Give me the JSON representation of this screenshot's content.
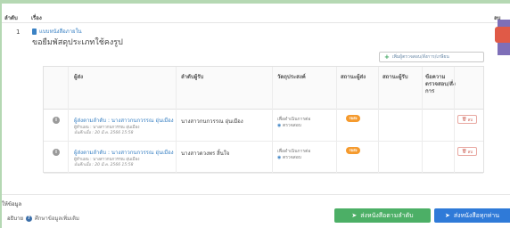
{
  "header": {
    "order": "ลำดับ",
    "subject": "เรื่อง",
    "right": "ลบ"
  },
  "document": {
    "row_number": "1",
    "type_link": "แบบหนังสือภายใน",
    "title": "ขอยืมพัสดุประเภทใช้คงรูป"
  },
  "add_button": {
    "label": "เพิ่มผู้ตรวจสอบ/สั่งการ/เกษียน"
  },
  "table": {
    "columns": [
      "ผู้ส่ง",
      "ลำดับผู้รับ",
      "วัตถุประสงค์",
      "สถานะผู้ส่ง",
      "สถานะผู้รับ",
      "ข้อความตรวจสอบ/สั่งการ"
    ],
    "rows": [
      {
        "info_icon": "i",
        "sender": "ผู้ส่งตามลำดับ : นางสาวกนกวรรณ อุ่นเมือง",
        "sender_sub": "ผู้ทำแผน : นางสาวกนกวรรณ อุ่นเมือง",
        "sender_date": "บันทึกเมื่อ : 20 มี.ค. 2566 15:58",
        "receiver": "นางสาวกนกวรรณ อุ่นเมือง",
        "purpose_line1": "เพื่อดำเนินการต่อ",
        "purpose_line2": "ตรวจสอบ",
        "status": "รอส่ง",
        "cancel": "ลบ"
      },
      {
        "info_icon": "i",
        "sender": "ผู้ส่งตามลำดับ : นางสาวกนกวรรณ อุ่นเมือง",
        "sender_sub": "ผู้ทำแผน : นางสาวกนกวรรณ อุ่นเมือง",
        "sender_date": "บันทึกเมื่อ : 20 มี.ค. 2566 15:58",
        "receiver": "นางสาวดวงพร สิ้นใจ",
        "purpose_line1": "เพื่อดำเนินการต่อ",
        "purpose_line2": "ตรวจสอบ",
        "status": "รอส่ง",
        "cancel": "ลบ"
      }
    ]
  },
  "footer": {
    "label": "ให้ข้อมูล",
    "explain": "อธิบาย",
    "note": "ศึกษาข้อมูลเพิ่มเติม"
  },
  "buttons": {
    "send_order": "ส่งหนังสือตามลำดับ",
    "send_all": "ส่งหนังสือทุกท่าน"
  },
  "colors": {
    "background_green": "#b5d8b3",
    "accent_blue": "#2f7ad8",
    "accent_green": "#4caf66",
    "status_orange": "#f59a2d",
    "delete_red": "#e05a47",
    "side_purple": "#7e6fb8"
  },
  "icons": {
    "file": "file-icon",
    "plus": "plus-icon",
    "info": "info-icon",
    "question": "question-icon",
    "send": "send-arrow-icon"
  }
}
